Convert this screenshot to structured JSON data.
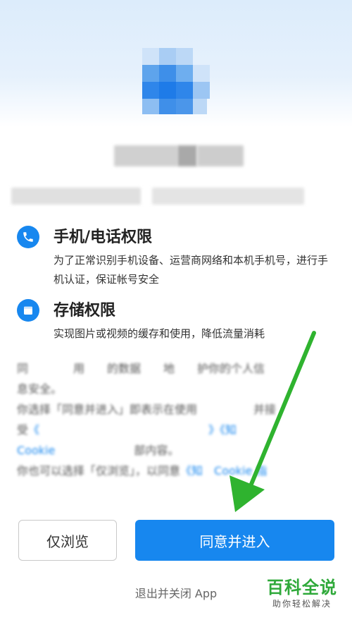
{
  "permissions": [
    {
      "icon": "phone-icon",
      "title": "手机/电话权限",
      "desc": "为了正常识别手机设备、运营商网络和本机手机号，进行手机认证，保证帐号安全"
    },
    {
      "icon": "storage-icon",
      "title": "存储权限",
      "desc": "实现图片或视频的缓存和使用，降低流量消耗"
    }
  ],
  "policy": {
    "line1": "同　　　　用　　的数据　　地　　护你的个人信",
    "line2": "息安全。",
    "line3": "你选择「同意并进入」即表示在使用　　　　　并接",
    "line4_a": "受",
    "line4_b": "《　　　　　　　　　　　　　　　》《知　",
    "line5_a": "Cookie",
    "line5_b": "　　　　　　　部内容。",
    "line6_a": "你也可以选择「仅浏览」，以同意",
    "line6_b": "《知　Cookie 指"
  },
  "buttons": {
    "browse": "仅浏览",
    "agree": "同意并进入",
    "exit": "退出并关闭 App"
  },
  "watermark": {
    "title": "百科全说",
    "subtitle": "助你轻松解决"
  },
  "colors": {
    "accent": "#1787ef",
    "arrow": "#2fb32f"
  }
}
